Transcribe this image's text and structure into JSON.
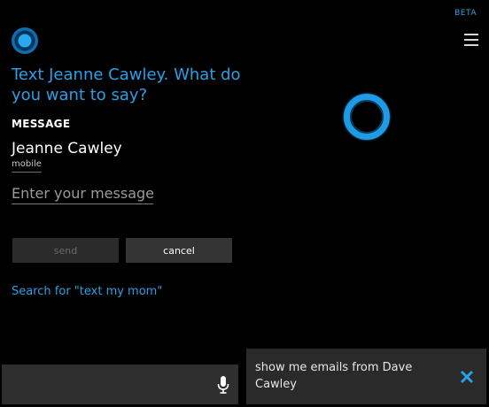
{
  "header": {
    "beta_label": "BETA"
  },
  "prompt": {
    "text": "Text Jeanne Cawley. What do you want to say?"
  },
  "message_section": {
    "label": "MESSAGE",
    "contact_name": "Jeanne Cawley",
    "contact_type": "mobile",
    "input_placeholder": "Enter your message.",
    "input_value": ""
  },
  "buttons": {
    "send_label": "send",
    "cancel_label": "cancel"
  },
  "search_link": {
    "text": "Search for \"text my mom\""
  },
  "suggestion": {
    "text": "show me emails from Dave Cawley"
  },
  "icons": {
    "cortana_small": "cortana-circle-icon",
    "cortana_big": "cortana-ring-icon",
    "menu": "hamburger-menu-icon",
    "microphone": "microphone-icon",
    "close": "close-icon"
  },
  "colors": {
    "accent": "#2aa0e6",
    "background": "#000000",
    "panel": "#2f2f2f"
  }
}
